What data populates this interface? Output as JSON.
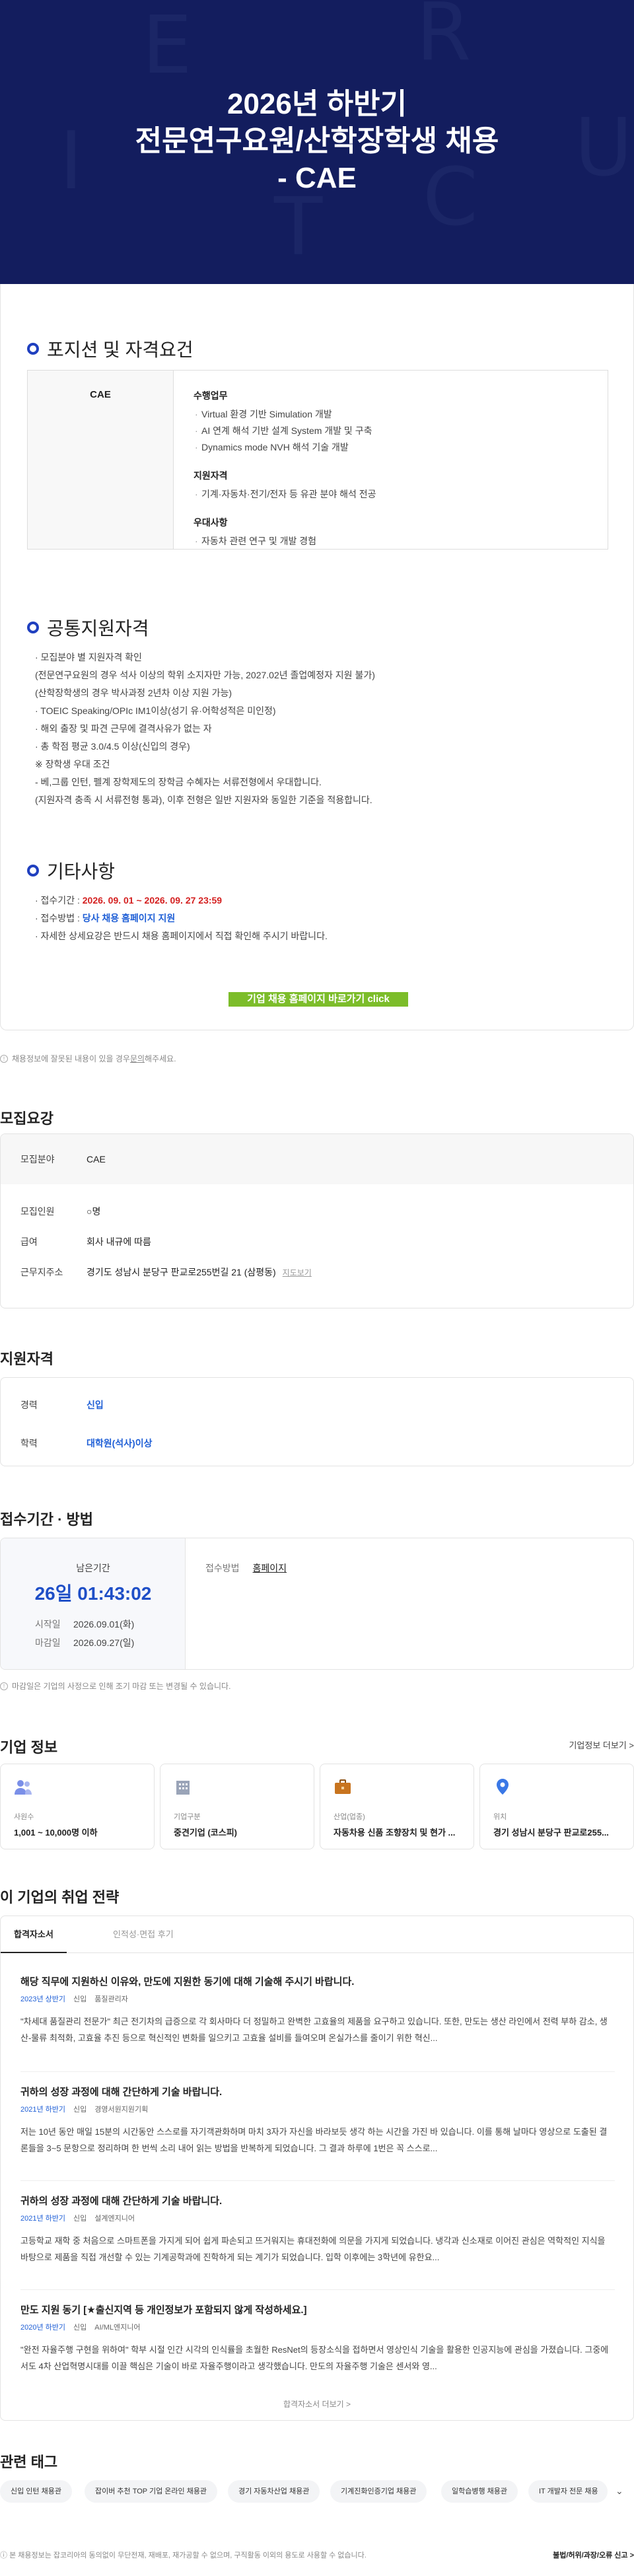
{
  "hero": {
    "title_line1": "2026년 하반기",
    "title_line2": "전문연구요원/산학장학생 채용",
    "title_line3": "- CAE",
    "bg_letters": [
      "E",
      "R",
      "I",
      "U",
      "T",
      "C"
    ]
  },
  "positions": {
    "heading": "포지션 및 자격요건",
    "field": "CAE",
    "duties_title": "수행업무",
    "duties": [
      "Virtual 환경 기반 Simulation 개발",
      "AI 연계 해석 기반 설계 System 개발 및 구축",
      "Dynamics mode NVH 해석 기술 개발"
    ],
    "req_title": "지원자격",
    "reqs": [
      "기계·자동차·전기/전자 등 유관 분야 해석 전공"
    ],
    "pref_title": "우대사항",
    "prefs": [
      "자동차 관련 연구 및 개발 경험"
    ]
  },
  "common": {
    "heading": "공통지원자격",
    "lines": [
      "· 모집분야 별 지원자격 확인",
      "  (전문연구요원의 경우 석사 이상의 학위 소지자만 가능, 2027.02년 졸업예정자 지원 불가)",
      "  (산학장학생의 경우 박사과정 2년차 이상 지원 가능)",
      "· TOEIC Speaking/OPIc IM1이상(성기 유·어학성적은 미인정)",
      "· 해외 출장 및 파견 근무에 결격사유가 없는 자",
      "· 총 학점 평균 3.0/4.5 이상(신입의 경우)",
      "※ 장학생 우대 조건",
      "  - 베,그룹 인턴, 펠계 장학제도의 장학금 수혜자는 서류전형에서 우대합니다.",
      "    (지원자격 충족 시 서류전형 통과), 이후 전형은 일반 지원자와 동일한 기준을 적용합니다."
    ]
  },
  "etc": {
    "heading": "기타사항",
    "period_label": "· 접수기간 : ",
    "period_value": "2026. 09. 01 ~ 2026. 09. 27  23:59",
    "method_label": "· 접수방법 : ",
    "method_value": "당사 채용 홈페이지 지원",
    "detail": "· 자세한 상세요강은 반드시 채용 홈페이지에서 직접 확인해 주시기 바랍니다.",
    "cta": "기업 채용 홈페이지 바로가기 click"
  },
  "report_note": {
    "text": "채용정보에 잘못된 내용이 있을 경우 ",
    "link": "문의",
    "tail": "해주세요."
  },
  "summary": {
    "heading": "모집요강",
    "rows": [
      {
        "k": "모집분야",
        "v": "CAE"
      },
      {
        "k": "모집인원",
        "v": "○명"
      },
      {
        "k": "급여",
        "v": "회사 내규에 따름"
      },
      {
        "k": "근무지주소",
        "v": "경기도 성남시 분당구 판교로255번길 21 (삼평동)",
        "map": "지도보기"
      }
    ]
  },
  "qualification": {
    "heading": "지원자격",
    "rows": [
      {
        "k": "경력",
        "v": "신입"
      },
      {
        "k": "학력",
        "v": "대학원(석사)이상"
      }
    ]
  },
  "apply": {
    "heading": "접수기간 · 방법",
    "remain_label": "남은기간",
    "remain": "26일 01:43:02",
    "start_label": "시작일",
    "start": "2026.09.01(화)",
    "end_label": "마감일",
    "end": "2026.09.27(일)",
    "method_label": "접수방법",
    "method": "홈페이지",
    "note": "마감일은 기업의 사정으로 인해 조기 마감 또는 변경될 수 있습니다."
  },
  "company": {
    "heading": "기업 정보",
    "more": "기업정보 더보기 >",
    "items": [
      {
        "icon": "people-icon",
        "k": "사원수",
        "v": "1,001 ~ 10,000명 이하",
        "color": "#7a8fe8"
      },
      {
        "icon": "building-icon",
        "k": "기업구분",
        "v": "중견기업 (코스피)",
        "color": "#9aa4b8"
      },
      {
        "icon": "briefcase-icon",
        "k": "산업(업종)",
        "v": "자동차용 신품 조향장치 및 현가 ...",
        "color": "#c8741e"
      },
      {
        "icon": "location-pin-icon",
        "k": "위치",
        "v": "경기 성남시 분당구 판교로255...",
        "color": "#3a78e6"
      }
    ]
  },
  "strategy": {
    "heading": "이 기업의 취업 전략",
    "tabs": [
      "합격자소서",
      "인적성·면접 후기"
    ],
    "articles": [
      {
        "title": "해당 직무에 지원하신 이유와, 만도에 지원한 동기에 대해 기술해 주시기 바랍니다.",
        "year": "2023년 상반기",
        "type": "신입",
        "job": "품질관리자",
        "body": "\"차세대 품질관리 전문가\" 최근 전기차의 급증으로 각 회사마다 더 정밀하고 완벽한 고효율의 제품을 요구하고 있습니다. 또한, 만도는 생산 라인에서 전력 부하 감소, 생산-물류 최적화, 고효율 추진 등으로 혁신적인 변화를 일으키고 고효율 설비를 들여오며 온실가스를 줄이기 위한 혁신..."
      },
      {
        "title": "귀하의 성장 과정에 대해 간단하게 기술 바랍니다.",
        "year": "2021년 하반기",
        "type": "신입",
        "job": "경영서원지원기획",
        "body": "저는 10년 동안 매일 15분의 시간동안 스스로를 자기객관화하며 마치 3자가 자신을 바라보듯 생각 하는 시간을 가진 바 있습니다. 이를 통해 날마다 영상으로 도출된 결론들을 3~5 문항으로 정리하며 한 번씩 소리 내어 읽는 방법을 반복하게 되었습니다. 그 결과 하루에 1번은 꼭 스스로..."
      },
      {
        "title": "귀하의 성장 과정에 대해 간단하게 기술 바랍니다.",
        "year": "2021년 하반기",
        "type": "신입",
        "job": "설계엔지니어",
        "body": "고등학교 재학 중 처음으로 스마트폰을 가지게 되어 쉽게 파손되고 뜨거워지는 휴대전화에 의문을 가지게 되었습니다. 냉각과 신소재로 이어진 관심은 역학적인 지식을 바탕으로 제품을 직접 개선할 수 있는 기계공학과에 진학하게 되는 계기가 되었습니다. 입학 이후에는 3학년에 유한요..."
      },
      {
        "title": "만도 지원 동기 [★출신지역 등 개인정보가 포함되지 않게 작성하세요.]",
        "year": "2020년 하반기",
        "type": "신입",
        "job": "AI/ML엔지니어",
        "body": "\"완전 자율주행 구현을 위하여\" 학부 시절 인간 시각의 인식률을 초월한 ResNet의 등장소식을 접하면서 영상인식 기술을 활용한 인공지능에 관심을 가졌습니다. 그중에서도 4차 산업혁명시대를 이끌 핵심은 기술이 바로 자율주행이라고 생각했습니다. 만도의 자율주행 기술은 센서와 영..."
      }
    ],
    "more": "합격자소서 더보기 >"
  },
  "tags": {
    "heading": "관련 태그",
    "items": [
      "신입 인턴 채용관",
      "잡이버 추천 TOP 기업 온라인 채용관",
      "경기 자동차산업 채용관",
      "기계진화인증기업 채용관",
      "일학습병행 채용관",
      "IT 개발자 전문 채용"
    ]
  },
  "footer": {
    "notice": "본 채용정보는 잡코리아의 동의없이 무단전재, 재배포, 재가공할 수 없으며, 구직활동 이외의 용도로 사용할 수 없습니다.",
    "report": "불법/허위/과장/오류 신고 >"
  }
}
